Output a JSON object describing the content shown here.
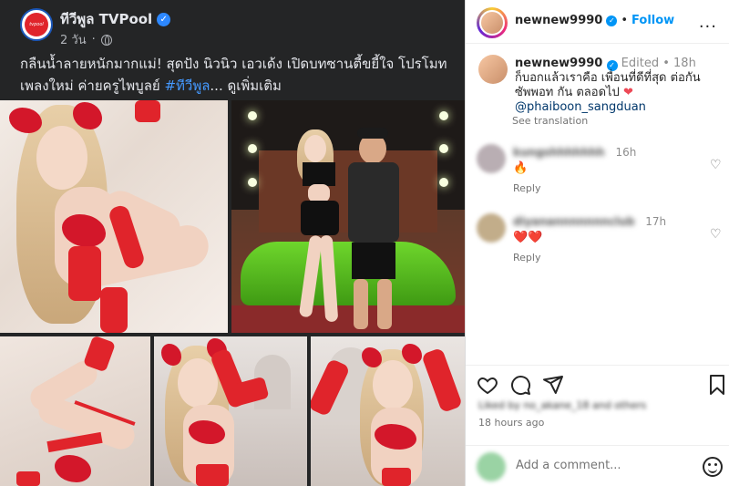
{
  "facebook_post": {
    "page_name": "ทีวีพูล TVPool",
    "logo_text": "tvpool",
    "time": "2 วัน",
    "text_line1": "กลืนน้ำลายหนักมากแม่! สุดปัง นิวนิว เอวเด้ง เปิดบทซานตี้ขยี้ใจ โปรโมท",
    "text_line2_prefix": "เพลงใหม่ ค่ายครูไพบูลย์ ",
    "hashtag": "#ทีวีพูล",
    "ellipsis": "...",
    "see_more": "ดูเพิ่มเติม"
  },
  "instagram": {
    "username": "newnew9990",
    "separator": "•",
    "follow_label": "Follow",
    "more_icon": "...",
    "caption": {
      "username": "newnew9990",
      "edited": "Edited",
      "separator": "•",
      "time": "18h",
      "text_line1": "ก็บอกแล้วเราคือ เพื่อนที่ดีที่สุด ต่อกัน",
      "text_line2": "ซัพพอท กัน ตลอดไป",
      "heart": "❤",
      "mention": "@phaiboon_sangduan",
      "see_translation": "See translation"
    },
    "comments": [
      {
        "username": "kungshhhhhhh",
        "time": "16h",
        "text": "🔥",
        "reply": "Reply",
        "avatar_color": "#b9aeb3"
      },
      {
        "username": "diyanannnnnnnclub",
        "time": "17h",
        "text": "❤️❤️",
        "reply": "Reply",
        "avatar_color": "#c2ad8a"
      }
    ],
    "liked_by": "Liked by no_akane_18 and others",
    "posted_time": "18 hours ago",
    "comment_placeholder": "Add a comment...",
    "icons": {
      "like": "heart-icon",
      "comment": "comment-icon",
      "share": "share-icon",
      "save": "bookmark-icon",
      "emoji": "emoji-icon"
    }
  },
  "colors": {
    "fb_background": "#242526",
    "fb_hashtag": "#4599ff",
    "ig_follow": "#0095f6",
    "ig_verified": "#0095f6",
    "fb_verified": "#2d88ff"
  }
}
